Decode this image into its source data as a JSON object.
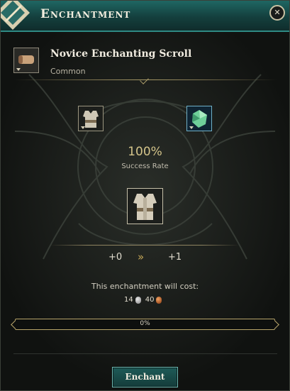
{
  "window": {
    "title": "Enchantment",
    "close_icon": "close-icon"
  },
  "item": {
    "name": "Novice Enchanting Scroll",
    "rarity": "Common",
    "icon": "scroll-icon"
  },
  "slots": {
    "left_icon": "vest-armor-icon",
    "right_icon": "green-gem-icon",
    "center_icon": "vest-armor-icon"
  },
  "success": {
    "value": "100%",
    "label": "Success Rate"
  },
  "levels": {
    "from": "+0",
    "arrows": "»",
    "to": "+1"
  },
  "cost": {
    "label": "This enchantment will cost:",
    "silver": "14",
    "copper": "40"
  },
  "progress": {
    "text": "0%",
    "fraction": 0
  },
  "button": {
    "label": "Enchant"
  },
  "colors": {
    "accent_teal": "#2f8a84",
    "gold": "#b7a46a"
  }
}
